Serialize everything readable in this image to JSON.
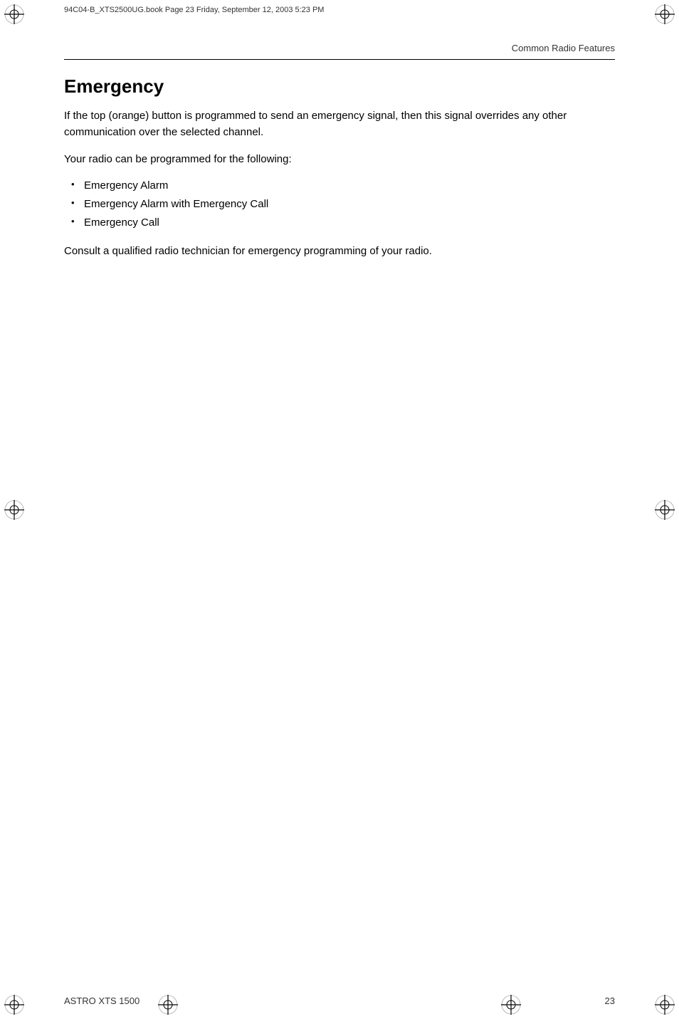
{
  "header": {
    "file_info": "94C04-B_XTS2500UG.book  Page 23  Friday, September 12, 2003  5:23 PM"
  },
  "chapter": {
    "title": "Common Radio Features"
  },
  "section": {
    "heading": "Emergency",
    "intro_paragraph": "If the top (orange) button is programmed to send an emergency signal, then this signal overrides any other communication over the selected channel.",
    "sub_intro": "Your radio can be programmed for the following:",
    "bullet_items": [
      "Emergency Alarm",
      "Emergency Alarm with Emergency Call",
      "Emergency Call"
    ],
    "closing_paragraph": "Consult a qualified radio technician for emergency programming of your radio."
  },
  "footer": {
    "left_text": "ASTRO XTS 1500",
    "right_text": "23"
  }
}
